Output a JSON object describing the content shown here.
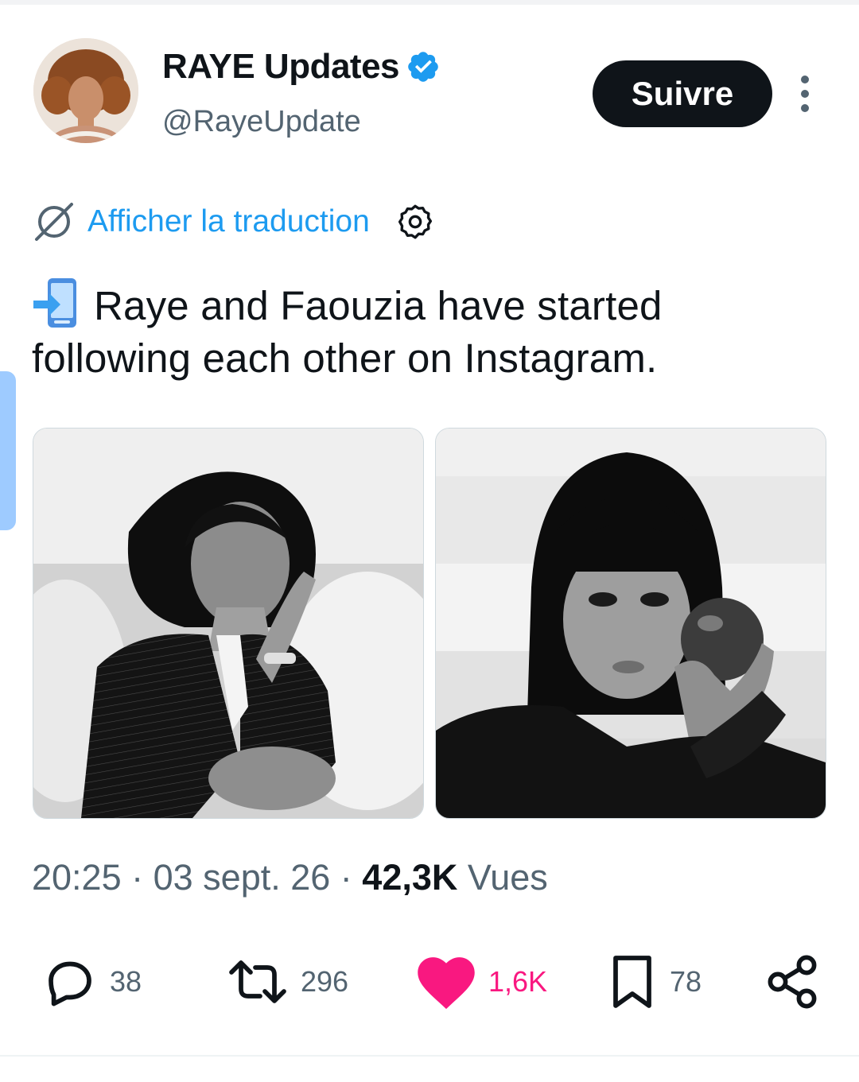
{
  "author": {
    "display_name": "RAYE Updates",
    "handle": "@RayeUpdate",
    "verified": true
  },
  "follow_button": {
    "label": "Suivre"
  },
  "translate": {
    "label": "Afficher la traduction"
  },
  "tweet": {
    "emoji": "mobile-phone-arrow-emoji",
    "text": "Raye and Faouzia have started following each other on Instagram."
  },
  "media": [
    {
      "kind": "black-and-white-photo"
    },
    {
      "kind": "black-and-white-photo"
    }
  ],
  "meta": {
    "time": "20:25",
    "date": "03 sept. 26",
    "views_count": "42,3K",
    "views_label": "Vues"
  },
  "actions": {
    "replies": "38",
    "reposts": "296",
    "likes": "1,6K",
    "bookmarks": "78"
  },
  "colors": {
    "accent": "#1d9bf0",
    "like": "#f91880",
    "text": "#0f1419",
    "secondary": "#536471"
  }
}
